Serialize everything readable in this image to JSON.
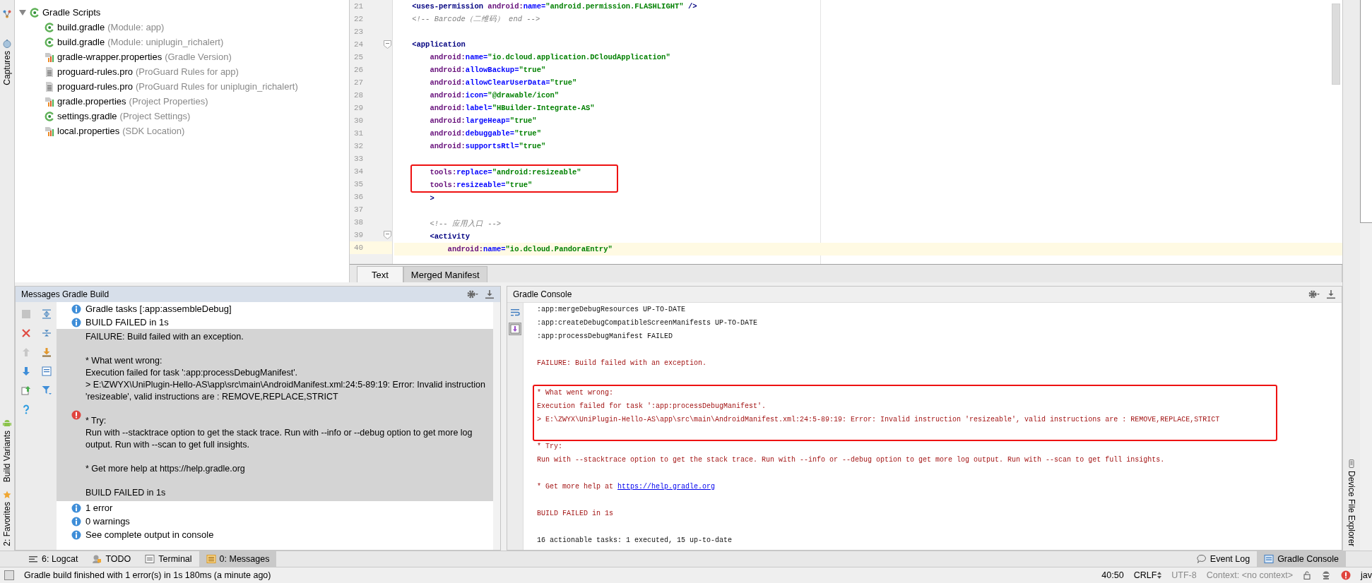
{
  "left_stripe": {
    "top_tabs": [
      {
        "label": "Captures",
        "kind": "captures"
      }
    ],
    "bottom_tabs": [
      {
        "label": "Build Variants",
        "kind": "android"
      },
      {
        "label": "2: Favorites",
        "kind": "star"
      }
    ]
  },
  "project_tree": {
    "items": [
      {
        "label": "Gradle Scripts",
        "kind": "gradle",
        "expanded": true,
        "children": [
          {
            "label": "build.gradle",
            "hint": "(Module: app)",
            "kind": "gradle"
          },
          {
            "label": "build.gradle",
            "hint": "(Module: uniplugin_richalert)",
            "kind": "gradle"
          },
          {
            "label": "gradle-wrapper.properties",
            "hint": "(Gradle Version)",
            "kind": "properties"
          },
          {
            "label": "proguard-rules.pro",
            "hint": "(ProGuard Rules for app)",
            "kind": "text"
          },
          {
            "label": "proguard-rules.pro",
            "hint": "(ProGuard Rules for uniplugin_richalert)",
            "kind": "text"
          },
          {
            "label": "gradle.properties",
            "hint": "(Project Properties)",
            "kind": "properties"
          },
          {
            "label": "settings.gradle",
            "hint": "(Project Settings)",
            "kind": "gradle"
          },
          {
            "label": "local.properties",
            "hint": "(SDK Location)",
            "kind": "properties"
          }
        ]
      }
    ]
  },
  "editor": {
    "lines": [
      {
        "number": "21",
        "fold": false,
        "current": false,
        "boxed": false,
        "tokens": [
          {
            "kind": "tag",
            "text": "    <uses-permission "
          },
          {
            "kind": "ns",
            "text": "android:"
          },
          {
            "kind": "attr",
            "text": "name="
          },
          {
            "kind": "value",
            "text": "\"android.permission.FLASHLIGHT\""
          },
          {
            "kind": "tag",
            "text": " />"
          }
        ]
      },
      {
        "number": "22",
        "fold": false,
        "current": false,
        "boxed": false,
        "tokens": [
          {
            "kind": "comment",
            "text": "    <!-- Barcode（二维码） end -->"
          }
        ]
      },
      {
        "number": "23",
        "fold": false,
        "current": false,
        "boxed": false
      },
      {
        "number": "24",
        "fold": true,
        "current": false,
        "boxed": false,
        "tokens": [
          {
            "kind": "tag",
            "text": "    <application"
          }
        ]
      },
      {
        "number": "25",
        "fold": false,
        "current": false,
        "boxed": false,
        "tokens": [
          {
            "kind": "ns",
            "text": "        android:"
          },
          {
            "kind": "attr",
            "text": "name="
          },
          {
            "kind": "value",
            "text": "\"io.dcloud.application.DCloudApplication\""
          }
        ]
      },
      {
        "number": "26",
        "fold": false,
        "current": false,
        "boxed": false,
        "tokens": [
          {
            "kind": "ns",
            "text": "        android:"
          },
          {
            "kind": "attr",
            "text": "allowBackup="
          },
          {
            "kind": "value",
            "text": "\"true\""
          }
        ]
      },
      {
        "number": "27",
        "fold": false,
        "current": false,
        "boxed": false,
        "tokens": [
          {
            "kind": "ns",
            "text": "        android:"
          },
          {
            "kind": "attr",
            "text": "allowClearUserData="
          },
          {
            "kind": "value",
            "text": "\"true\""
          }
        ]
      },
      {
        "number": "28",
        "fold": false,
        "current": false,
        "boxed": false,
        "tokens": [
          {
            "kind": "ns",
            "text": "        android:"
          },
          {
            "kind": "attr",
            "text": "icon="
          },
          {
            "kind": "value",
            "text": "\"@drawable/icon\""
          }
        ]
      },
      {
        "number": "29",
        "fold": false,
        "current": false,
        "boxed": false,
        "tokens": [
          {
            "kind": "ns",
            "text": "        android:"
          },
          {
            "kind": "attr",
            "text": "label="
          },
          {
            "kind": "value",
            "text": "\"HBuilder-Integrate-AS\""
          }
        ]
      },
      {
        "number": "30",
        "fold": false,
        "current": false,
        "boxed": false,
        "tokens": [
          {
            "kind": "ns",
            "text": "        android:"
          },
          {
            "kind": "attr",
            "text": "largeHeap="
          },
          {
            "kind": "value",
            "text": "\"true\""
          }
        ]
      },
      {
        "number": "31",
        "fold": false,
        "current": false,
        "boxed": false,
        "tokens": [
          {
            "kind": "ns",
            "text": "        android:"
          },
          {
            "kind": "attr",
            "text": "debuggable="
          },
          {
            "kind": "value",
            "text": "\"true\""
          }
        ]
      },
      {
        "number": "32",
        "fold": false,
        "current": false,
        "boxed": false,
        "tokens": [
          {
            "kind": "ns",
            "text": "        android:"
          },
          {
            "kind": "attr",
            "text": "supportsRtl="
          },
          {
            "kind": "value",
            "text": "\"true\""
          }
        ]
      },
      {
        "number": "33",
        "fold": false,
        "current": false,
        "boxed": false
      },
      {
        "number": "34",
        "fold": false,
        "current": false,
        "boxed": true,
        "tokens": [
          {
            "kind": "ns",
            "text": "        tools:"
          },
          {
            "kind": "attr",
            "text": "replace="
          },
          {
            "kind": "value",
            "text": "\"android:resizeable\""
          }
        ]
      },
      {
        "number": "35",
        "fold": false,
        "current": false,
        "boxed": true,
        "tokens": [
          {
            "kind": "ns",
            "text": "        tools:"
          },
          {
            "kind": "attr",
            "text": "resizeable="
          },
          {
            "kind": "value",
            "text": "\"true\""
          }
        ]
      },
      {
        "number": "36",
        "fold": false,
        "current": false,
        "boxed": false,
        "tokens": [
          {
            "kind": "tag",
            "text": "        >"
          }
        ]
      },
      {
        "number": "37",
        "fold": false,
        "current": false,
        "boxed": false
      },
      {
        "number": "38",
        "fold": false,
        "current": false,
        "boxed": false,
        "tokens": [
          {
            "kind": "comment",
            "text": "        <!-- 应用入口 -->"
          }
        ]
      },
      {
        "number": "39",
        "fold": true,
        "current": false,
        "boxed": false,
        "tokens": [
          {
            "kind": "tag",
            "text": "        <activity"
          }
        ]
      },
      {
        "number": "40",
        "fold": false,
        "current": true,
        "boxed": false,
        "tokens": [
          {
            "kind": "ns",
            "text": "            android:"
          },
          {
            "kind": "attr",
            "text": "name="
          },
          {
            "kind": "value",
            "text": "\"io.dcloud.PandoraEntry\""
          }
        ]
      }
    ],
    "tabs": [
      {
        "label": "Text",
        "selected": true
      },
      {
        "label": "Merged Manifest",
        "selected": false
      }
    ]
  },
  "messages_panel": {
    "title": "Messages Gradle Build",
    "entries": [
      {
        "kind": "info",
        "selected": false,
        "text": "Gradle tasks [:app:assembleDebug]"
      },
      {
        "kind": "info",
        "selected": false,
        "text": "BUILD FAILED in 1s"
      },
      {
        "kind": "error",
        "selected": true,
        "paragraphs": [
          [
            "FAILURE: Build failed with an exception."
          ],
          [
            "* What went wrong:",
            "Execution failed for task ':app:processDebugManifest'.",
            "> E:\\ZWYX\\UniPlugin-Hello-AS\\app\\src\\main\\AndroidManifest.xml:24:5-89:19: Error: Invalid instruction 'resizeable', valid instructions are : REMOVE,REPLACE,STRICT"
          ],
          [
            "* Try:",
            "Run with --stacktrace option to get the stack trace. Run with --info or --debug option to get more log output. Run with --scan to get full insights."
          ],
          [
            "* Get more help at https://help.gradle.org"
          ],
          [
            "BUILD FAILED in 1s"
          ]
        ]
      },
      {
        "kind": "info",
        "selected": false,
        "text": "1 error"
      },
      {
        "kind": "info",
        "selected": false,
        "text": "0 warnings"
      },
      {
        "kind": "info",
        "selected": false,
        "text": "See complete output in console"
      }
    ]
  },
  "gradle_console": {
    "title": "Gradle Console",
    "lines": [
      {
        "kind": "normal",
        "boxed": false,
        "text": ":app:mergeDebugResources UP-TO-DATE"
      },
      {
        "kind": "normal",
        "boxed": false,
        "text": ":app:createDebugCompatibleScreenManifests UP-TO-DATE"
      },
      {
        "kind": "normal",
        "boxed": false,
        "text": ":app:processDebugManifest FAILED"
      },
      {
        "kind": "blank"
      },
      {
        "kind": "error",
        "boxed": false,
        "text": "FAILURE: Build failed with an exception."
      },
      {
        "kind": "blank"
      },
      {
        "kind": "error",
        "boxed": true,
        "text": "* What went wrong:"
      },
      {
        "kind": "error",
        "boxed": true,
        "text": "Execution failed for task ':app:processDebugManifest'."
      },
      {
        "kind": "error",
        "boxed": true,
        "text": "> E:\\ZWYX\\UniPlugin-Hello-AS\\app\\src\\main\\AndroidManifest.xml:24:5-89:19: Error: Invalid instruction 'resizeable', valid instructions are : REMOVE,REPLACE,STRICT"
      },
      {
        "kind": "blank",
        "boxed": true
      },
      {
        "kind": "error",
        "boxed": false,
        "text": "* Try:"
      },
      {
        "kind": "error",
        "boxed": false,
        "text": "Run with --stacktrace option to get the stack trace. Run with --info or --debug option to get more log output. Run with --scan to get full insights."
      },
      {
        "kind": "blank"
      },
      {
        "kind": "error",
        "boxed": false,
        "text": "* Get more help at ",
        "link": "https://help.gradle.org"
      },
      {
        "kind": "blank"
      },
      {
        "kind": "error",
        "boxed": false,
        "text": "BUILD FAILED in 1s"
      },
      {
        "kind": "blank"
      },
      {
        "kind": "normal",
        "boxed": false,
        "text": "16 actionable tasks: 1 executed, 15 up-to-date"
      }
    ]
  },
  "right_stripe": {
    "tabs": [
      {
        "label": "Device File Explorer",
        "kind": "device"
      }
    ]
  },
  "tool_window_bar": {
    "left": [
      {
        "label": "6: Logcat",
        "kind": "logcat",
        "selected": false
      },
      {
        "label": "TODO",
        "kind": "todo",
        "selected": false
      },
      {
        "label": "Terminal",
        "kind": "terminal",
        "selected": false
      },
      {
        "label": "0: Messages",
        "kind": "messages",
        "selected": true
      }
    ],
    "right": [
      {
        "label": "Event Log",
        "kind": "eventlog",
        "selected": false
      },
      {
        "label": "Gradle Console",
        "kind": "console",
        "selected": true
      }
    ]
  },
  "status_bar": {
    "message": "Gradle build finished with 1 error(s) in 1s 180ms (a minute ago)",
    "position": "40:50",
    "line_separator": "CRLF",
    "encoding": "UTF-8",
    "context": "Context: <no context>",
    "language": "jav"
  }
}
